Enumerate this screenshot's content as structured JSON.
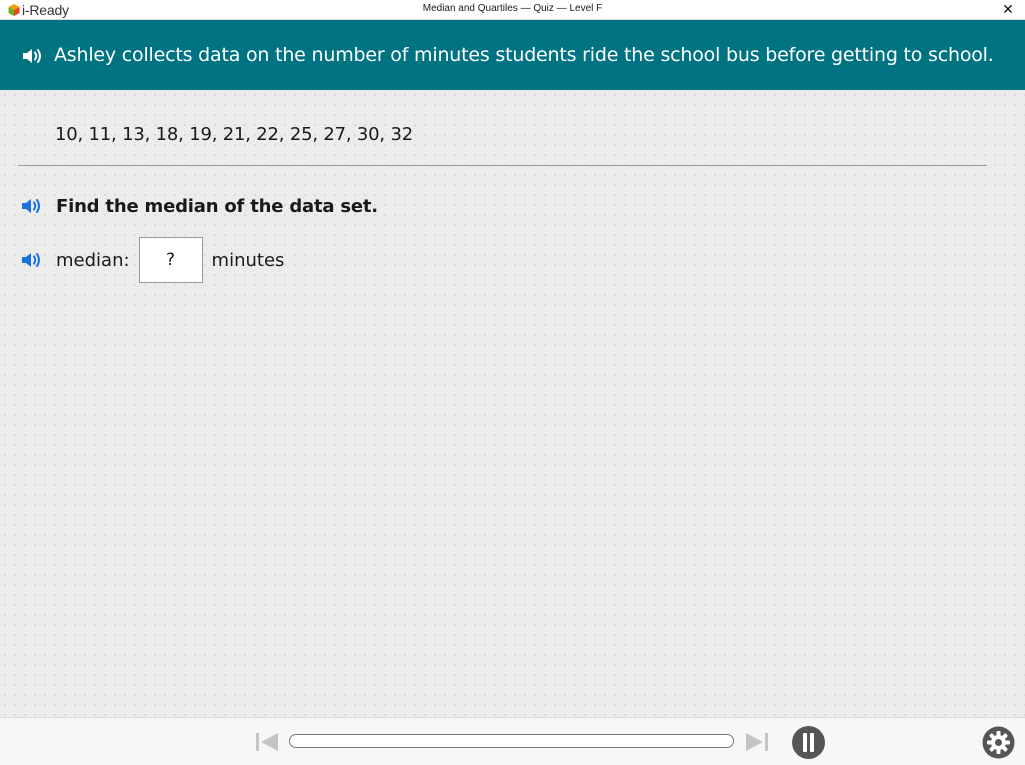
{
  "app": {
    "logo_text": "i-Ready",
    "window_title": "Median and Quartiles — Quiz — Level F",
    "close_glyph": "✕"
  },
  "banner": {
    "prompt": "Ashley collects data on the number of minutes students ride the school bus before getting to school.",
    "speaker_icon": "speaker-icon"
  },
  "problem": {
    "dataset": "10, 11, 13, 18, 19, 21, 22, 25, 27, 30, 32",
    "question": "Find the median of the data set.",
    "answer_label": "median:",
    "answer_placeholder": "?",
    "unit": "minutes"
  },
  "footer": {
    "progress_fraction": 0,
    "icons": [
      "skip-back-icon",
      "skip-forward-icon",
      "pause-icon",
      "gear-icon"
    ]
  },
  "colors": {
    "banner": "#007382",
    "speaker_blue": "#1a73d9",
    "control_gray": "#555555"
  }
}
